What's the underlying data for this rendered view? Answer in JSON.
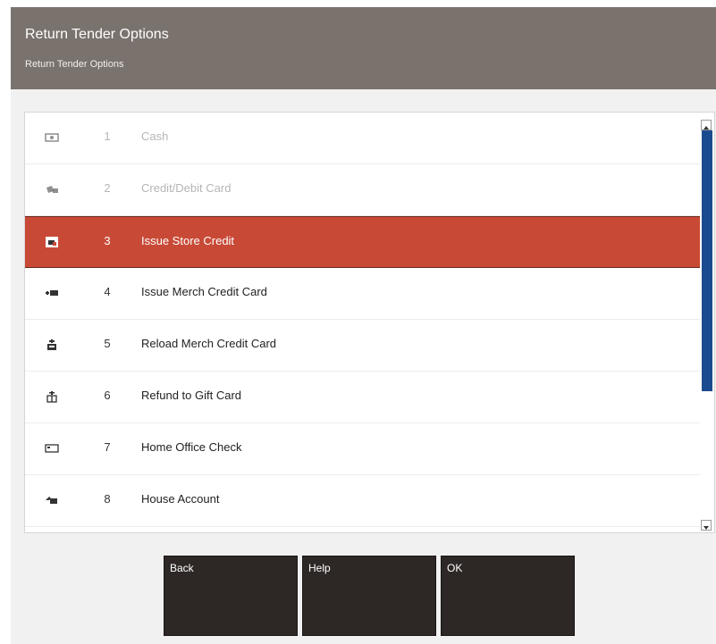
{
  "header": {
    "title": "Return Tender Options",
    "subtitle": "Return Tender Options"
  },
  "list": {
    "items": [
      {
        "num": "1",
        "label": "Cash",
        "icon": "cash-icon",
        "state": "disabled"
      },
      {
        "num": "2",
        "label": "Credit/Debit Card",
        "icon": "credit-card-icon",
        "state": "disabled"
      },
      {
        "num": "3",
        "label": "Issue Store Credit",
        "icon": "store-credit-icon",
        "state": "selected"
      },
      {
        "num": "4",
        "label": "Issue Merch Credit Card",
        "icon": "merch-card-icon",
        "state": "normal"
      },
      {
        "num": "5",
        "label": "Reload Merch Credit Card",
        "icon": "reload-card-icon",
        "state": "normal"
      },
      {
        "num": "6",
        "label": "Refund to Gift Card",
        "icon": "gift-card-icon",
        "state": "normal"
      },
      {
        "num": "7",
        "label": "Home Office Check",
        "icon": "check-icon",
        "state": "normal"
      },
      {
        "num": "8",
        "label": "House Account",
        "icon": "house-account-icon",
        "state": "normal"
      }
    ]
  },
  "buttons": {
    "back": "Back",
    "help": "Help",
    "ok": "OK"
  },
  "colors": {
    "header_bg": "#7a726d",
    "selected_row": "#c84a36",
    "button_bg": "#2d2826",
    "scroll_thumb": "#1b4b8f",
    "dialog_bg": "#f1f1f1"
  }
}
